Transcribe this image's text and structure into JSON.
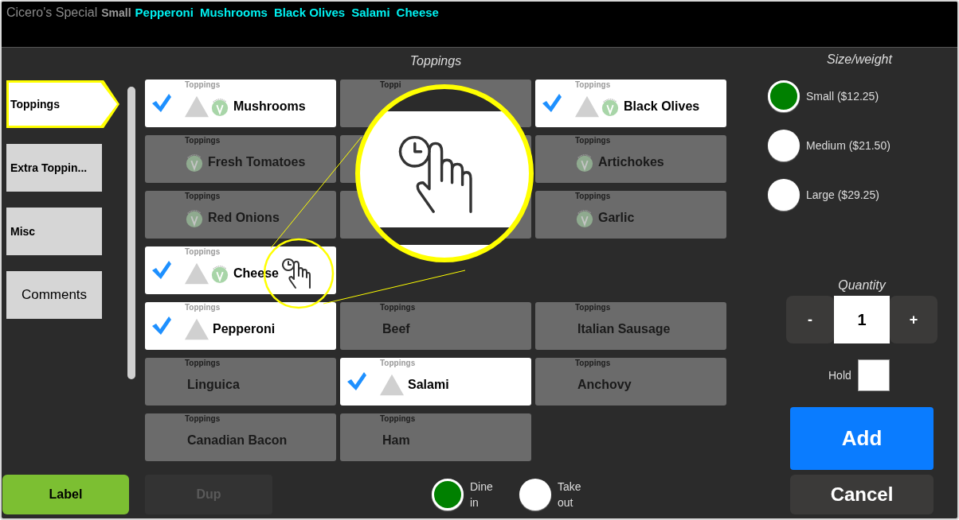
{
  "order_line": {
    "title": "Cicero's Special",
    "size": "Small",
    "items": [
      "Pepperoni",
      "Mushrooms",
      "Black Olives",
      "Salami",
      "Cheese"
    ]
  },
  "tabs": [
    {
      "label": "Toppings",
      "selected": true,
      "kind": "category"
    },
    {
      "label": "Extra Toppin...",
      "selected": false,
      "kind": "category"
    },
    {
      "label": "Misc",
      "selected": false,
      "kind": "category"
    },
    {
      "label": "Comments",
      "selected": false,
      "kind": "note"
    }
  ],
  "grid": {
    "title": "Toppings",
    "cells": [
      {
        "kind": "item",
        "category": "Toppings",
        "name": "Mushrooms",
        "selected": true,
        "triangle": true,
        "vegetarian": true
      },
      {
        "kind": "covered",
        "category": "Toppi"
      },
      {
        "kind": "item",
        "category": "Toppings",
        "name": "Black Olives",
        "selected": true,
        "triangle": true,
        "vegetarian": true
      },
      {
        "kind": "item",
        "category": "Toppings",
        "name": "Fresh Tomatoes",
        "selected": false,
        "triangle": false,
        "vegetarian": true
      },
      {
        "kind": "covered"
      },
      {
        "kind": "item",
        "category": "Toppings",
        "name": "Artichokes",
        "selected": false,
        "triangle": false,
        "vegetarian": true
      },
      {
        "kind": "item",
        "category": "Toppings",
        "name": "Red Onions",
        "selected": false,
        "triangle": false,
        "vegetarian": true
      },
      {
        "kind": "covered"
      },
      {
        "kind": "item",
        "category": "Toppings",
        "name": "Garlic",
        "selected": false,
        "triangle": false,
        "vegetarian": true
      },
      {
        "kind": "item",
        "category": "Toppings",
        "name": "Cheese",
        "selected": true,
        "triangle": true,
        "vegetarian": true
      },
      {
        "kind": "empty"
      },
      {
        "kind": "empty"
      },
      {
        "kind": "item",
        "category": "Toppings",
        "name": "Pepperoni",
        "selected": true,
        "triangle": true,
        "vegetarian": false
      },
      {
        "kind": "item",
        "category": "Toppings",
        "name": "Beef",
        "selected": false,
        "triangle": false,
        "vegetarian": false
      },
      {
        "kind": "item",
        "category": "Toppings",
        "name": "Italian Sausage",
        "selected": false,
        "triangle": false,
        "vegetarian": false
      },
      {
        "kind": "item",
        "category": "Toppings",
        "name": "Linguica",
        "selected": false,
        "triangle": false,
        "vegetarian": false
      },
      {
        "kind": "item",
        "category": "Toppings",
        "name": "Salami",
        "selected": true,
        "triangle": true,
        "vegetarian": false
      },
      {
        "kind": "item",
        "category": "Toppings",
        "name": "Anchovy",
        "selected": false,
        "triangle": false,
        "vegetarian": false
      },
      {
        "kind": "item",
        "category": "Toppings",
        "name": "Canadian Bacon",
        "selected": false,
        "triangle": false,
        "vegetarian": false
      },
      {
        "kind": "item",
        "category": "Toppings",
        "name": "Ham",
        "selected": false,
        "triangle": false,
        "vegetarian": false
      },
      {
        "kind": "empty"
      }
    ]
  },
  "sizes": {
    "title": "Size/weight",
    "options": [
      {
        "label": "Small ($12.25)",
        "selected": true
      },
      {
        "label": "Medium ($21.50)",
        "selected": false
      },
      {
        "label": "Large ($29.25)",
        "selected": false
      }
    ]
  },
  "quantity": {
    "title": "Quantity",
    "minus": "-",
    "value": "1",
    "plus": "+"
  },
  "hold": {
    "label": "Hold",
    "checked": false
  },
  "buttons": {
    "add": "Add",
    "cancel": "Cancel",
    "label": "Label",
    "dup": "Dup"
  },
  "service": [
    {
      "label": "Dine in",
      "selected": true
    },
    {
      "label": "Take out",
      "selected": false
    }
  ]
}
